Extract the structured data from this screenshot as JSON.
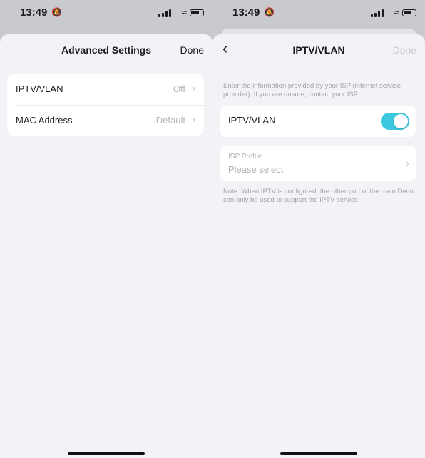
{
  "left_screen": {
    "status_time": "13:49",
    "header": {
      "title": "Advanced Settings",
      "done_label": "Done"
    },
    "rows": [
      {
        "label": "IPTV/VLAN",
        "value": "Off"
      },
      {
        "label": "MAC Address",
        "value": "Default"
      }
    ]
  },
  "right_screen": {
    "status_time": "13:49",
    "header": {
      "title": "IPTV/VLAN",
      "done_label": "Done"
    },
    "intro_text": "Enter the information provided by your ISP (internet service provider). If you are unsure, contact your ISP.",
    "toggle": {
      "label": "IPTV/VLAN",
      "on": true
    },
    "isp_profile": {
      "label": "ISP Profile",
      "value": "Please select"
    },
    "note_text": "Note: When IPTV is configured, the other port of the main Deco can only be used to support the IPTV service."
  },
  "colors": {
    "accent": "#3bc8de",
    "background": "#f2f2f7"
  },
  "icons": [
    "silent-bell-icon",
    "signal-icon",
    "wifi-icon",
    "battery-icon",
    "chevron-right-icon",
    "back-chevron-icon"
  ]
}
